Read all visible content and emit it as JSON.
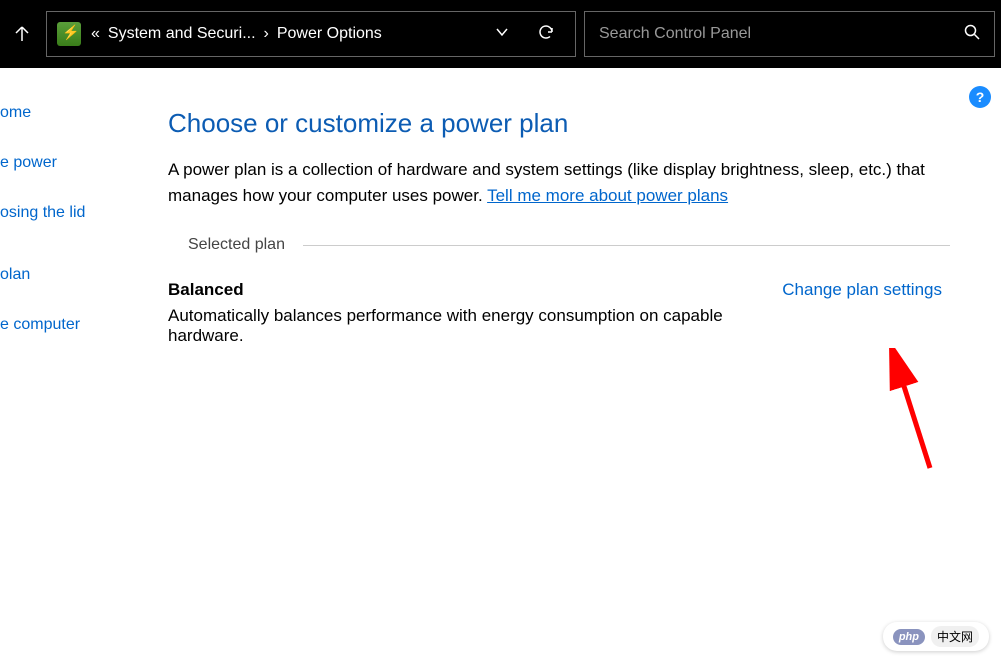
{
  "breadcrumb": {
    "prefix": "«",
    "item1": "System and Securi...",
    "sep": "›",
    "item2": "Power Options"
  },
  "search": {
    "placeholder": "Search Control Panel"
  },
  "sidebar": {
    "items": [
      "ome",
      "e power",
      "osing the lid",
      "olan",
      "e computer"
    ]
  },
  "main": {
    "title": "Choose or customize a power plan",
    "description_pre": "A power plan is a collection of hardware and system settings (like display brightness, sleep, etc.) that manages how your computer uses power. ",
    "tell_more": "Tell me more about power plans",
    "section_label": "Selected plan",
    "plan": {
      "name": "Balanced",
      "desc": "Automatically balances performance with energy consumption on capable hardware.",
      "change_link": "Change plan settings"
    }
  },
  "help_icon": "?",
  "watermark": {
    "php": "php",
    "cn": "中文网"
  }
}
